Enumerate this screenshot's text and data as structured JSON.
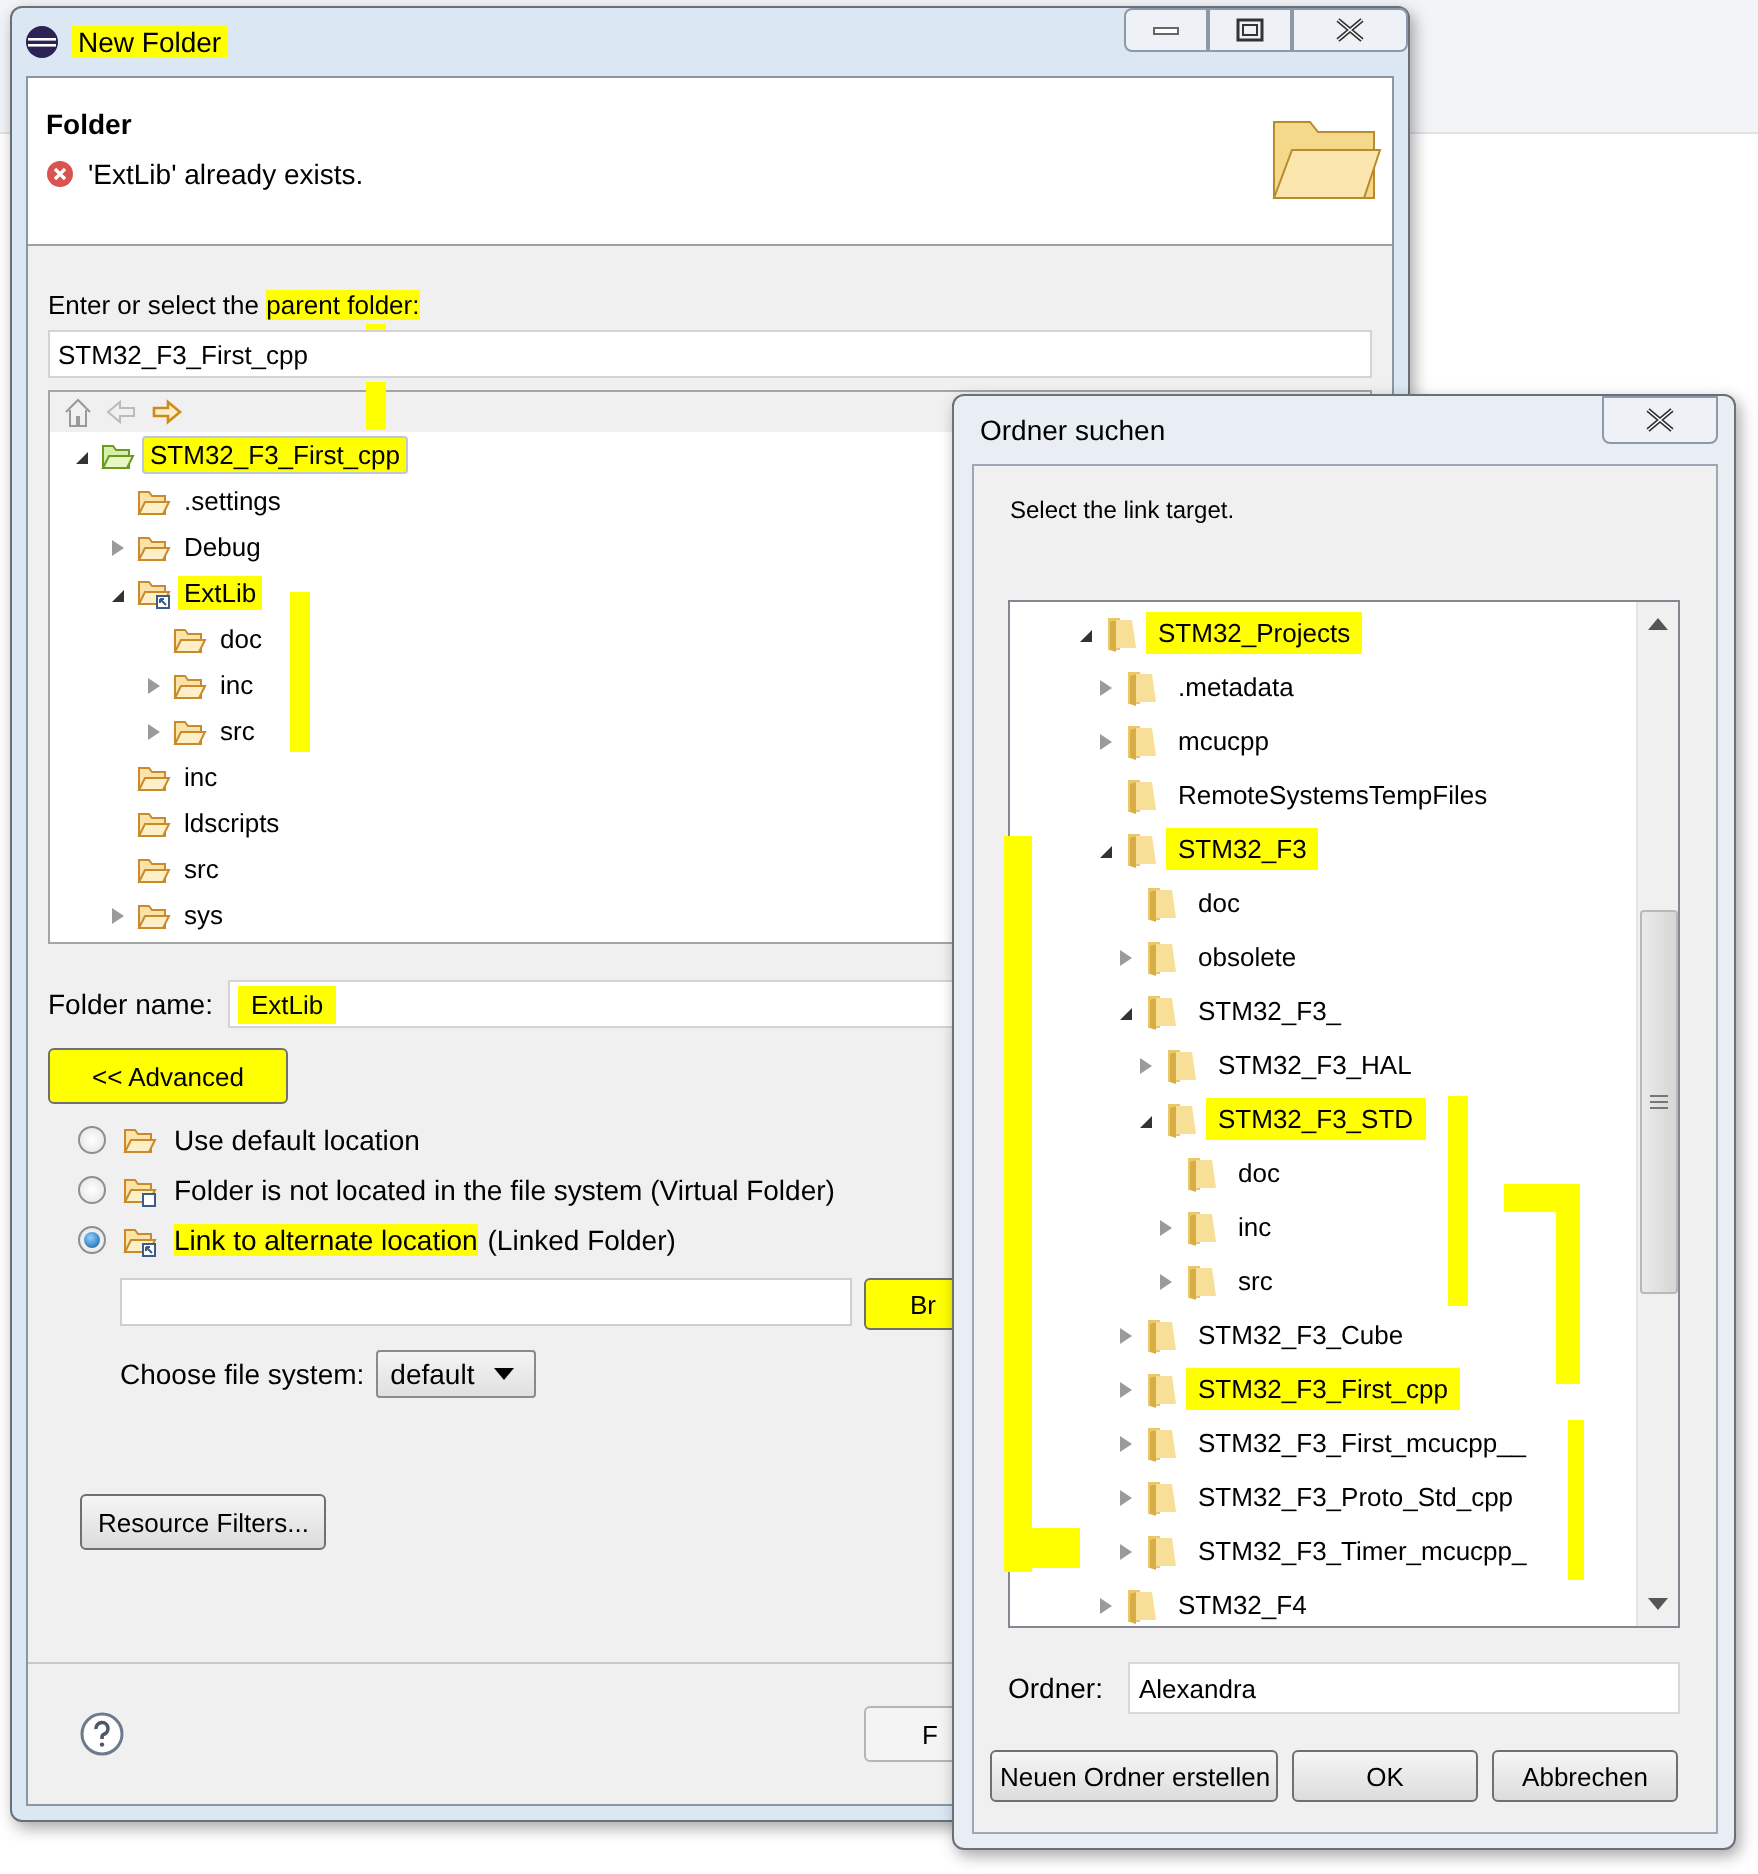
{
  "new_folder_dialog": {
    "title": {
      "text": "New Folder",
      "highlighted": true
    },
    "heading": "Folder",
    "error_message": "'ExtLib' already exists.",
    "parent_label": [
      {
        "text": "Enter or select the ",
        "highlighted": false
      },
      {
        "text": "parent folder:",
        "highlighted": true
      }
    ],
    "parent_value": "STM32_F3_First_cpp",
    "tree": [
      {
        "label": "STM32_F3_First_cpp",
        "kind": "project",
        "expandable": true,
        "expanded": true,
        "selected": true,
        "highlighted": true,
        "children": [
          {
            "label": ".settings",
            "kind": "folder",
            "expandable": false,
            "selected": false,
            "highlighted": false
          },
          {
            "label": "Debug",
            "kind": "folder",
            "expandable": true,
            "expanded": false,
            "selected": false,
            "highlighted": false
          },
          {
            "label": "ExtLib",
            "kind": "linked",
            "expandable": true,
            "expanded": true,
            "selected": false,
            "highlighted": true,
            "children": [
              {
                "label": "doc",
                "kind": "folder",
                "expandable": false,
                "selected": false,
                "highlighted": false
              },
              {
                "label": "inc",
                "kind": "folder",
                "expandable": true,
                "expanded": false,
                "selected": false,
                "highlighted": false
              },
              {
                "label": "src",
                "kind": "folder",
                "expandable": true,
                "expanded": false,
                "selected": false,
                "highlighted": false
              }
            ]
          },
          {
            "label": "inc",
            "kind": "folder",
            "expandable": false,
            "selected": false,
            "highlighted": false
          },
          {
            "label": "ldscripts",
            "kind": "folder",
            "expandable": false,
            "selected": false,
            "highlighted": false
          },
          {
            "label": "src",
            "kind": "folder",
            "expandable": false,
            "selected": false,
            "highlighted": false
          },
          {
            "label": "sys",
            "kind": "folder",
            "expandable": true,
            "expanded": false,
            "selected": false,
            "highlighted": false
          }
        ]
      }
    ],
    "folder_name_label": "Folder name:",
    "folder_name": {
      "value": "ExtLib",
      "highlighted": true
    },
    "advanced_button": {
      "label": "<< Advanced",
      "highlighted": true
    },
    "location_options": [
      {
        "kind": "default",
        "label": [
          {
            "text": "Use default location",
            "highlighted": false
          }
        ],
        "selected": false
      },
      {
        "kind": "virtual",
        "label": [
          {
            "text": "Folder is not located in the file system (Virtual Folder)",
            "highlighted": false
          }
        ],
        "selected": false
      },
      {
        "kind": "linked",
        "label": [
          {
            "text": "Link to alternate location",
            "highlighted": true
          },
          {
            "text": " (Linked Folder)",
            "highlighted": false
          }
        ],
        "selected": true
      }
    ],
    "browse_button": {
      "label": "Br",
      "highlighted": true
    },
    "file_system_label": "Choose file system:",
    "file_system_value": "default",
    "resource_filters_button": "Resource Filters...",
    "finish_button": "F"
  },
  "folder_browser": {
    "title": "Ordner suchen",
    "instruction": "Select the link target.",
    "tree": [
      {
        "label": "STM32_Projects",
        "expandable": true,
        "expanded": true,
        "highlighted": true,
        "children": [
          {
            "label": ".metadata",
            "expandable": true,
            "expanded": false,
            "highlighted": false
          },
          {
            "label": "mcucpp",
            "expandable": true,
            "expanded": false,
            "highlighted": false
          },
          {
            "label": "RemoteSystemsTempFiles",
            "expandable": false,
            "highlighted": false
          },
          {
            "label": "STM32_F3",
            "expandable": true,
            "expanded": true,
            "highlighted": true,
            "children": [
              {
                "label": "doc",
                "expandable": false,
                "highlighted": false
              },
              {
                "label": "obsolete",
                "expandable": true,
                "expanded": false,
                "highlighted": false
              },
              {
                "label": "STM32_F3_",
                "expandable": true,
                "expanded": true,
                "highlighted": false,
                "children": [
                  {
                    "label": "STM32_F3_HAL",
                    "expandable": true,
                    "expanded": false,
                    "highlighted": false
                  },
                  {
                    "label": "STM32_F3_STD",
                    "expandable": true,
                    "expanded": true,
                    "highlighted": true,
                    "children": [
                      {
                        "label": "doc",
                        "expandable": false,
                        "highlighted": false
                      },
                      {
                        "label": "inc",
                        "expandable": true,
                        "expanded": false,
                        "highlighted": false
                      },
                      {
                        "label": "src",
                        "expandable": true,
                        "expanded": false,
                        "highlighted": false
                      }
                    ]
                  }
                ]
              },
              {
                "label": "STM32_F3_Cube",
                "expandable": true,
                "expanded": false,
                "highlighted": false
              },
              {
                "label": "STM32_F3_First_cpp",
                "expandable": true,
                "expanded": false,
                "highlighted": true
              },
              {
                "label": "STM32_F3_First_mcucpp__",
                "expandable": true,
                "expanded": false,
                "highlighted": false
              },
              {
                "label": "STM32_F3_Proto_Std_cpp",
                "expandable": true,
                "expanded": false,
                "highlighted": false
              },
              {
                "label": "STM32_F3_Timer_mcucpp_",
                "expandable": true,
                "expanded": false,
                "highlighted": false
              }
            ]
          },
          {
            "label": "STM32_F4",
            "expandable": true,
            "expanded": false,
            "highlighted": false
          }
        ]
      }
    ],
    "folder_label": "Ordner:",
    "folder_value": "Alexandra",
    "buttons": [
      "Neuen Ordner erstellen",
      "OK",
      "Abbrechen"
    ]
  }
}
